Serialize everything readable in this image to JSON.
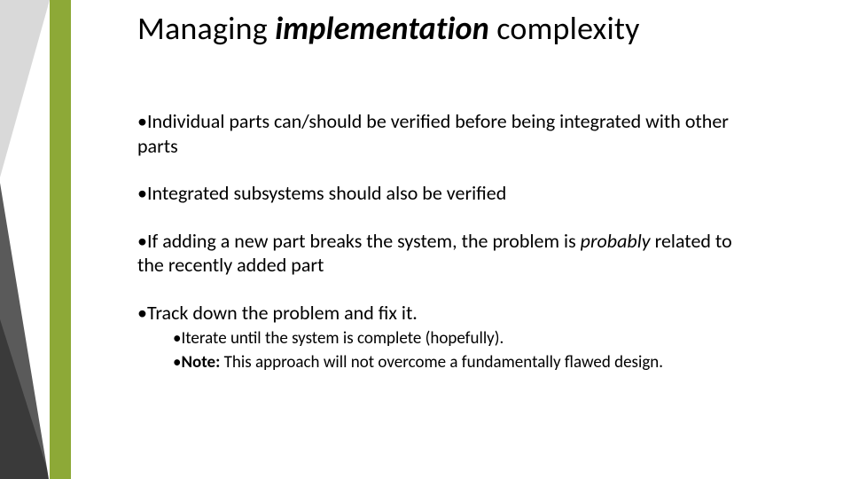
{
  "title": {
    "pre": "Managing ",
    "emph": "implementation",
    "post": " complexity"
  },
  "bullets": [
    {
      "level": 1,
      "runs": [
        {
          "text": "Individual parts can/should be verified before being integrated with other parts"
        }
      ]
    },
    {
      "level": 1,
      "runs": [
        {
          "text": "Integrated subsystems should also be verified"
        }
      ]
    },
    {
      "level": 1,
      "runs": [
        {
          "text": "If adding a new part breaks the system, the problem is "
        },
        {
          "text": "probably",
          "italic": true
        },
        {
          "text": " related to the recently added part"
        }
      ]
    },
    {
      "level": 1,
      "runs": [
        {
          "text": "Track down the problem and fix it."
        }
      ],
      "tight": true
    },
    {
      "level": 2,
      "runs": [
        {
          "text": "Iterate until the system is complete (hopefully)."
        }
      ]
    },
    {
      "level": 2,
      "runs": [
        {
          "text": "Note:",
          "bold": true
        },
        {
          "text": " This approach will not overcome a fundamentally flawed design."
        }
      ]
    }
  ],
  "colors": {
    "accent_green": "#8DA937",
    "grey_light": "#D6D6D6",
    "grey_dark": "#3F3F3F"
  }
}
